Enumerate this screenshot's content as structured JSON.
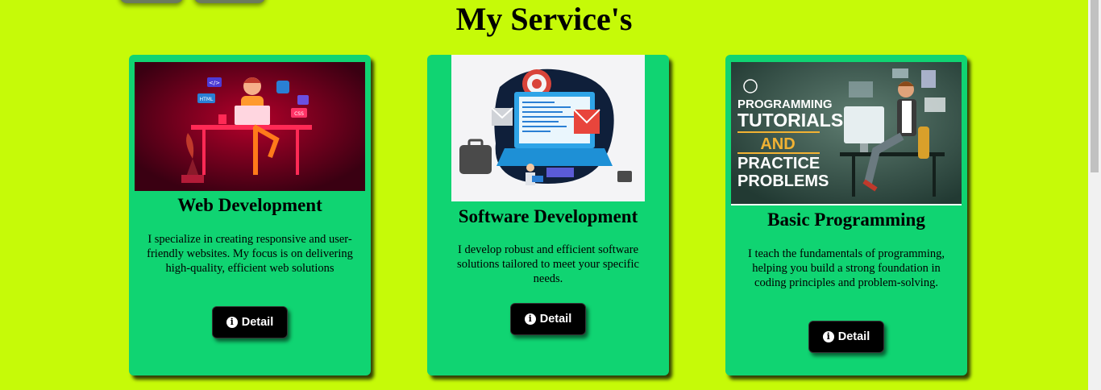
{
  "page": {
    "title": "My Service's"
  },
  "services": [
    {
      "title": "Web Development",
      "description": "I specialize in creating responsive and user-friendly websites. My focus is on delivering high-quality, efficient web solutions",
      "button_label": "Detail",
      "image_text": [
        "</>",
        "HTML",
        "CSS"
      ]
    },
    {
      "title": "Software Development",
      "description": "I develop robust and efficient software solutions tailored to meet your specific needs.",
      "button_label": "Detail"
    },
    {
      "title": "Basic Programming",
      "description": "I teach the fundamentals of programming, helping you build a strong foundation in coding principles and problem-solving.",
      "button_label": "Detail",
      "image_text": [
        "PROGRAMMING",
        "TUTORIALS",
        "AND",
        "PRACTICE",
        "PROBLEMS"
      ]
    }
  ],
  "colors": {
    "background": "#c6fa08",
    "card": "#10d472",
    "button": "#000000"
  },
  "icons": {
    "detail": "info-circle-icon"
  }
}
